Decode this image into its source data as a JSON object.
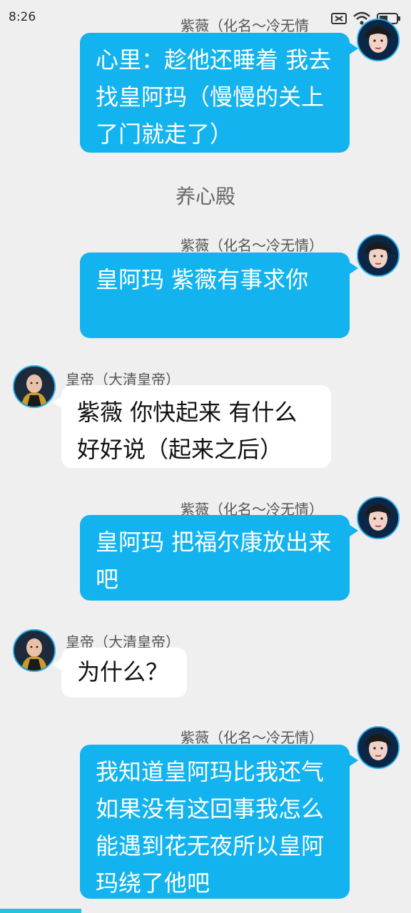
{
  "status_bar": {
    "time": "8:26"
  },
  "colors": {
    "self_bubble": "#12b3ee",
    "other_bubble": "#ffffff",
    "background": "#efefef",
    "avatar_ring": "#27aee8"
  },
  "messages": [
    {
      "sender": "紫薇（化名～冷无情",
      "side": "right",
      "text": "心里：趁他还睡着 我去找皇阿玛（慢慢的关上了门就走了）"
    },
    {
      "type": "system",
      "text": "养心殿"
    },
    {
      "sender": "紫薇（化名～冷无情）",
      "side": "right",
      "text": "皇阿玛 紫薇有事求你"
    },
    {
      "sender": "皇帝（大清皇帝）",
      "side": "left",
      "text": "紫薇 你快起来 有什么好好说（起来之后）"
    },
    {
      "sender": "紫薇（化名～冷无情）",
      "side": "right",
      "text": "皇阿玛 把福尔康放出来吧"
    },
    {
      "sender": "皇帝（大清皇帝）",
      "side": "left",
      "text": "为什么？"
    },
    {
      "sender": "紫薇（化名～冷无情）",
      "side": "right",
      "text": "我知道皇阿玛比我还气 如果没有这回事我怎么能遇到花无夜所以皇阿玛绕了他吧"
    }
  ]
}
